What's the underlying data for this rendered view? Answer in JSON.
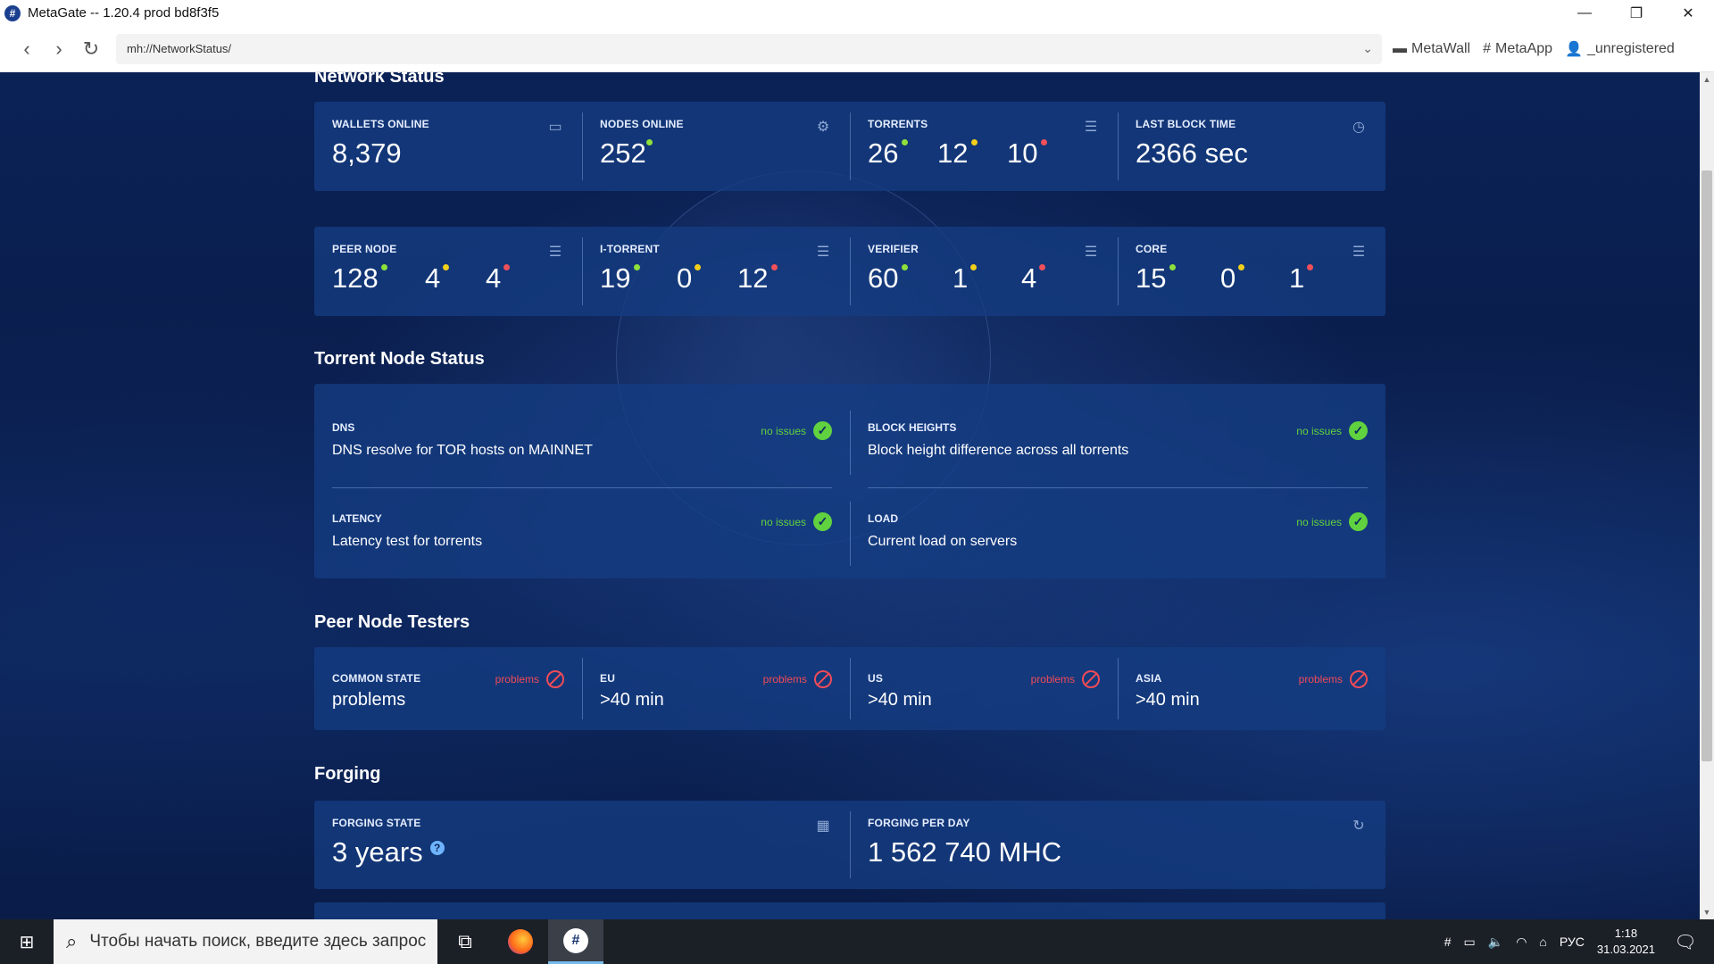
{
  "window": {
    "title": "MetaGate -- 1.20.4 prod bd8f3f5",
    "logo": "#",
    "minimize": "—",
    "restore": "❐",
    "close": "✕"
  },
  "nav": {
    "back": "‹",
    "forward": "›",
    "reload": "↻",
    "url": "mh://NetworkStatus/",
    "dropdown": "⌄",
    "links": [
      {
        "label": "MetaWall",
        "icon": "wallet-icon"
      },
      {
        "label": "MetaApp",
        "icon": "hash-icon"
      },
      {
        "label": "_unregistered",
        "icon": "user-icon"
      }
    ]
  },
  "network_status": {
    "title": "Network Status",
    "top": [
      {
        "label": "WALLETS ONLINE",
        "value": "8,379",
        "icon": "wallet-icon"
      },
      {
        "label": "NODES ONLINE",
        "value": "252",
        "icon": "nodes-icon",
        "status": "green"
      },
      {
        "label": "TORRENTS",
        "values": [
          "26",
          "12",
          "10"
        ],
        "icon": "server-icon"
      },
      {
        "label": "LAST BLOCK TIME",
        "value": "2366 sec",
        "icon": "clock-icon"
      }
    ],
    "bottom": [
      {
        "label": "PEER NODE",
        "values": [
          "128",
          "4",
          "4"
        ],
        "icon": "server-icon"
      },
      {
        "label": "I-TORRENT",
        "values": [
          "19",
          "0",
          "12"
        ],
        "icon": "server-icon"
      },
      {
        "label": "VERIFIER",
        "values": [
          "60",
          "1",
          "4"
        ],
        "icon": "server-icon"
      },
      {
        "label": "CORE",
        "values": [
          "15",
          "0",
          "1"
        ],
        "icon": "server-icon"
      }
    ]
  },
  "torrent_node_status": {
    "title": "Torrent Node Status",
    "items": [
      {
        "label": "DNS",
        "desc": "DNS resolve for TOR hosts on MAINNET",
        "status": "no issues"
      },
      {
        "label": "BLOCK HEIGHTS",
        "desc": "Block height difference across all torrents",
        "status": "no issues"
      },
      {
        "label": "LATENCY",
        "desc": "Latency test for torrents",
        "status": "no issues"
      },
      {
        "label": "LOAD",
        "desc": "Current load on servers",
        "status": "no issues"
      }
    ]
  },
  "peer_node_testers": {
    "title": "Peer Node Testers",
    "items": [
      {
        "label": "COMMON STATE",
        "value": "problems",
        "status": "problems"
      },
      {
        "label": "EU",
        "value": ">40 min",
        "status": "problems"
      },
      {
        "label": "US",
        "value": ">40 min",
        "status": "problems"
      },
      {
        "label": "ASIA",
        "value": ">40 min",
        "status": "problems"
      }
    ]
  },
  "forging": {
    "title": "Forging",
    "state_label": "FORGING STATE",
    "state_value": "3 years",
    "help": "?",
    "per_day_label": "FORGING PER DAY",
    "per_day_value": "1 562 740 MHC",
    "state_icon": "calendar-icon",
    "per_day_icon": "24h-icon"
  },
  "taskbar": {
    "search_placeholder": "Чтобы начать поиск, введите здесь запрос",
    "lang": "РУС",
    "time": "1:18",
    "date": "31.03.2021"
  },
  "colors": {
    "accent": "#0b2457",
    "ok": "#61d23f",
    "problem": "#f04b57",
    "dot_green": "#8ee03a",
    "dot_yellow": "#f2cf1a",
    "dot_red": "#f0505a"
  }
}
